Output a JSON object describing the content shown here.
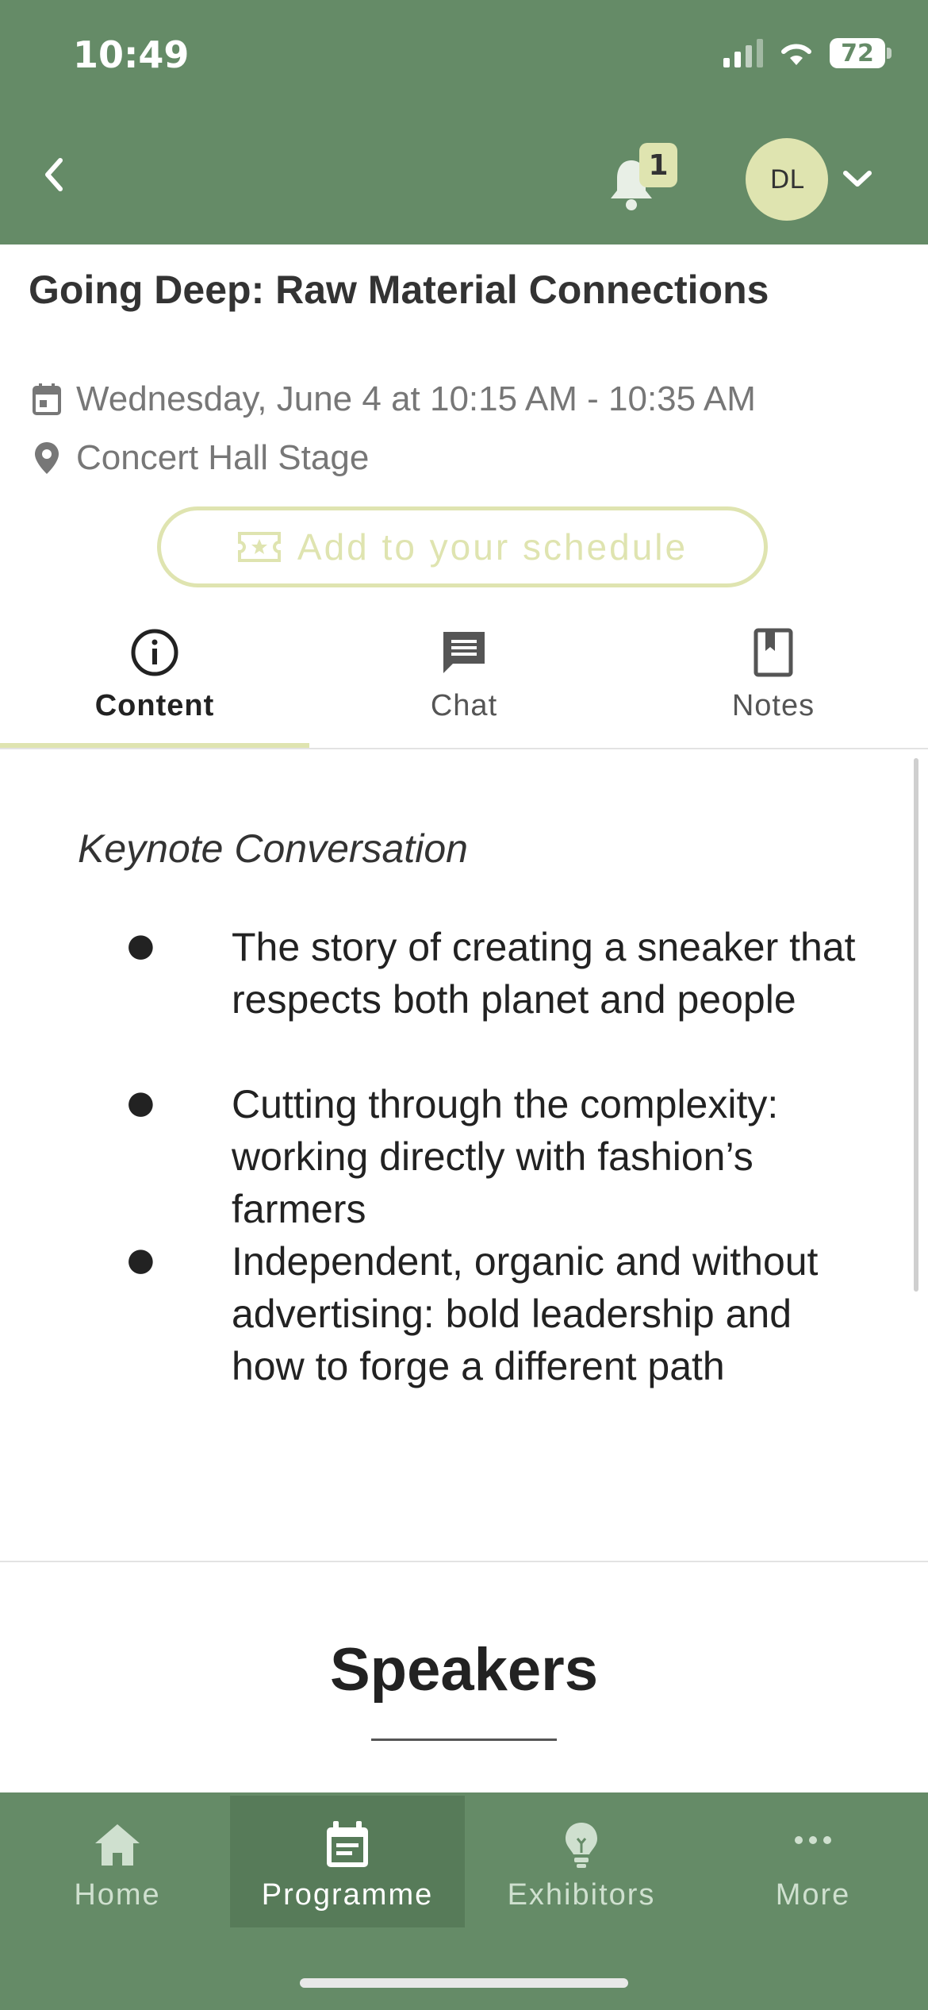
{
  "status_bar": {
    "time": "10:49",
    "battery": "72"
  },
  "header": {
    "notification_count": "1",
    "avatar_initials": "DL"
  },
  "session": {
    "title": "Going Deep: Raw Material Connections",
    "datetime": "Wednesday, June 4 at 10:15 AM - 10:35 AM",
    "location": "Concert Hall Stage",
    "add_schedule_label": "Add to your schedule"
  },
  "tabs": [
    {
      "label": "Content",
      "icon": "info-icon",
      "active": true
    },
    {
      "label": "Chat",
      "icon": "chat-icon",
      "active": false
    },
    {
      "label": "Notes",
      "icon": "bookmark-icon",
      "active": false
    }
  ],
  "content": {
    "subtitle": "Keynote Conversation",
    "bullets": [
      "The story of creating a sneaker that respects both planet and people",
      "Cutting through the complexity: working directly with fashion’s farmers",
      "Independent, organic and without advertising: bold leadership and how to forge a different path"
    ],
    "speakers_heading": "Speakers"
  },
  "bottom_nav": [
    {
      "label": "Home",
      "icon": "home-icon",
      "active": false
    },
    {
      "label": "Programme",
      "icon": "calendar-icon",
      "active": true
    },
    {
      "label": "Exhibitors",
      "icon": "lightbulb-icon",
      "active": false
    },
    {
      "label": "More",
      "icon": "more-dots-icon",
      "active": false
    }
  ],
  "colors": {
    "header_green": "#658b67",
    "accent_lime": "#dfe4b0",
    "active_nav": "#577b59"
  }
}
